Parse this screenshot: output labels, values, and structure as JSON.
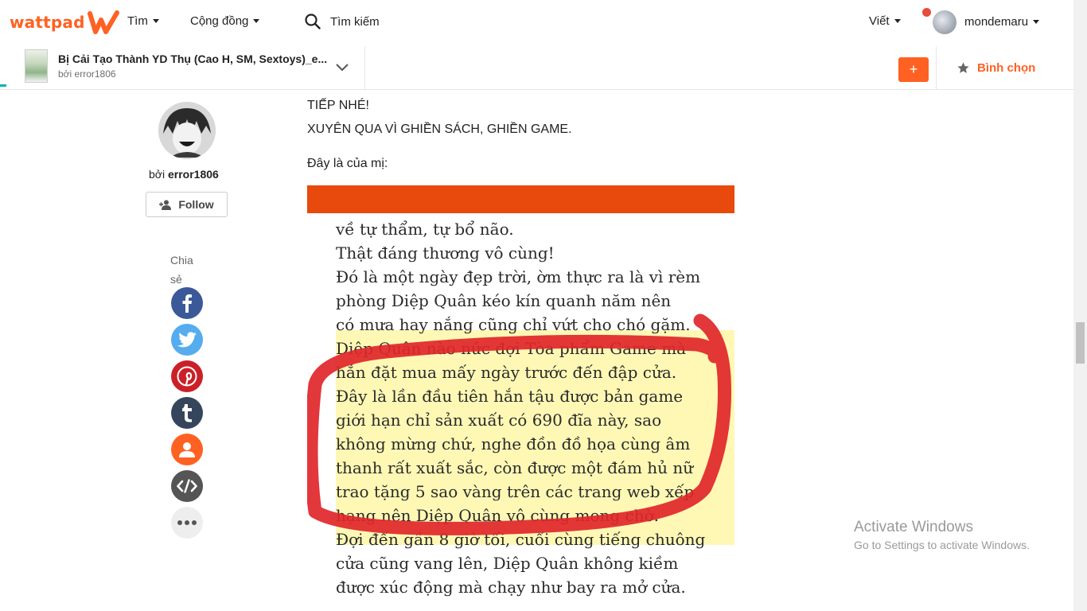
{
  "header": {
    "logo_text": "wattpad",
    "nav": {
      "browse": "Tìm",
      "community": "Cộng đồng",
      "search_placeholder": "Tìm kiếm",
      "write": "Viết",
      "username": "mondemaru"
    }
  },
  "story": {
    "title": "Bị Cải Tạo Thành YD Thụ (Cao H, SM, Sextoys)_e...",
    "author_line": "bởi error1806",
    "vote_label": "Bình chọn",
    "add_label": "+"
  },
  "author": {
    "prefix": "bởi ",
    "name": "error1806",
    "follow_label": "Follow"
  },
  "share": {
    "label": "Chia sẻ",
    "items": [
      "facebook",
      "twitter",
      "pinterest",
      "tumblr",
      "profile",
      "embed",
      "more"
    ]
  },
  "content": {
    "line1": "TIẾP NHÉ!",
    "line2": "XUYÊN QUA VÌ GHIỀN SÁCH, GHIỀN GAME.",
    "line3": "Đây là của mị:",
    "image_lines": [
      "về tự thẩm, tự bổ não.",
      "Thật đáng thương vô cùng!",
      "Đó là một ngày đẹp trời, ờm thực ra là vì rèm",
      "phòng Diệp Quân kéo kín quanh năm nên",
      "có mưa hay nắng cũng chỉ vứt cho chó gặm.",
      "Diệp Quân nào nức đợi Tòa phẩm Game mà",
      "hắn đặt mua mấy ngày trước đến đập cửa.",
      "Đây là lần đầu tiên hắn tậu được bản game",
      "giới hạn chỉ sản xuất có 690 đĩa này, sao",
      "không mừng chứ, nghe đồn đồ họa cùng âm",
      "thanh rất xuất sắc, còn được một đám hủ nữ",
      "trao tặng 5 sao vàng trên các trang web xếp",
      "hạng nên Diệp Quân vô cùng mong chờ.",
      "Đợi đến gần 8 giờ tối, cuối cùng tiếng chuông",
      "cửa cũng vang lên, Diệp Quân không kiềm",
      "được xúc động mà chạy như bay ra mở cửa."
    ]
  },
  "watermark": {
    "title": "Activate Windows",
    "subtitle": "Go to Settings to activate Windows."
  },
  "colors": {
    "brand": "#ff6122",
    "facebook": "#3b5998",
    "twitter": "#55acee",
    "pinterest": "#cb2027",
    "tumblr": "#35465c",
    "profile": "#ff6122",
    "embed": "#555555",
    "more": "#eeeeee",
    "red_marker": "#e0262a",
    "highlight": "#fff378"
  }
}
